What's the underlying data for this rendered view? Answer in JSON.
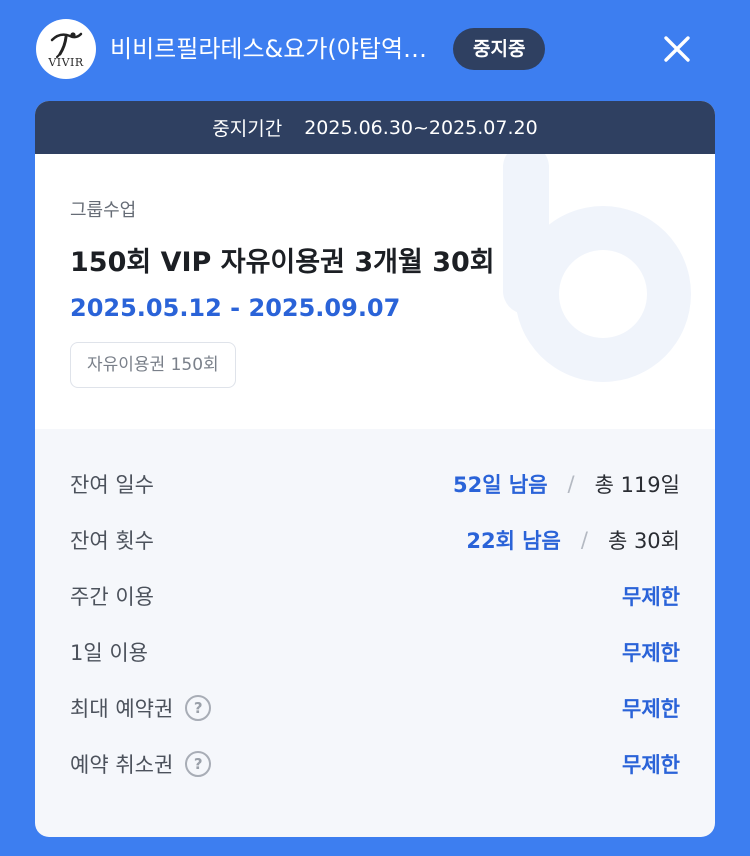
{
  "header": {
    "logo_text": "VIVIR",
    "studio_name": "비비르필라테스&요가(야탑역점...",
    "status_badge": "중지중",
    "close_icon": "close-icon"
  },
  "card": {
    "pause_bar": {
      "label": "중지기간",
      "period": "2025.06.30~2025.07.20"
    },
    "category": "그룹수업",
    "pass_title": "150회 VIP 자유이용권 3개월 30회",
    "pass_dates": "2025.05.12 - 2025.09.07",
    "pass_tag": "자유이용권 150회",
    "rows": [
      {
        "label": "잔여 일수",
        "remaining": "52일 남음",
        "separator": "/",
        "total": "총 119일"
      },
      {
        "label": "잔여 횟수",
        "remaining": "22회 남음",
        "separator": "/",
        "total": "총 30회"
      },
      {
        "label": "주간 이용",
        "value": "무제한"
      },
      {
        "label": "1일 이용",
        "value": "무제한"
      },
      {
        "label": "최대 예약권",
        "value": "무제한",
        "help": "?"
      },
      {
        "label": "예약 취소권",
        "value": "무제한",
        "help": "?"
      }
    ]
  },
  "colors": {
    "background": "#3d7ef0",
    "badge": "#2f4061",
    "accent_blue": "#2a63d8"
  }
}
